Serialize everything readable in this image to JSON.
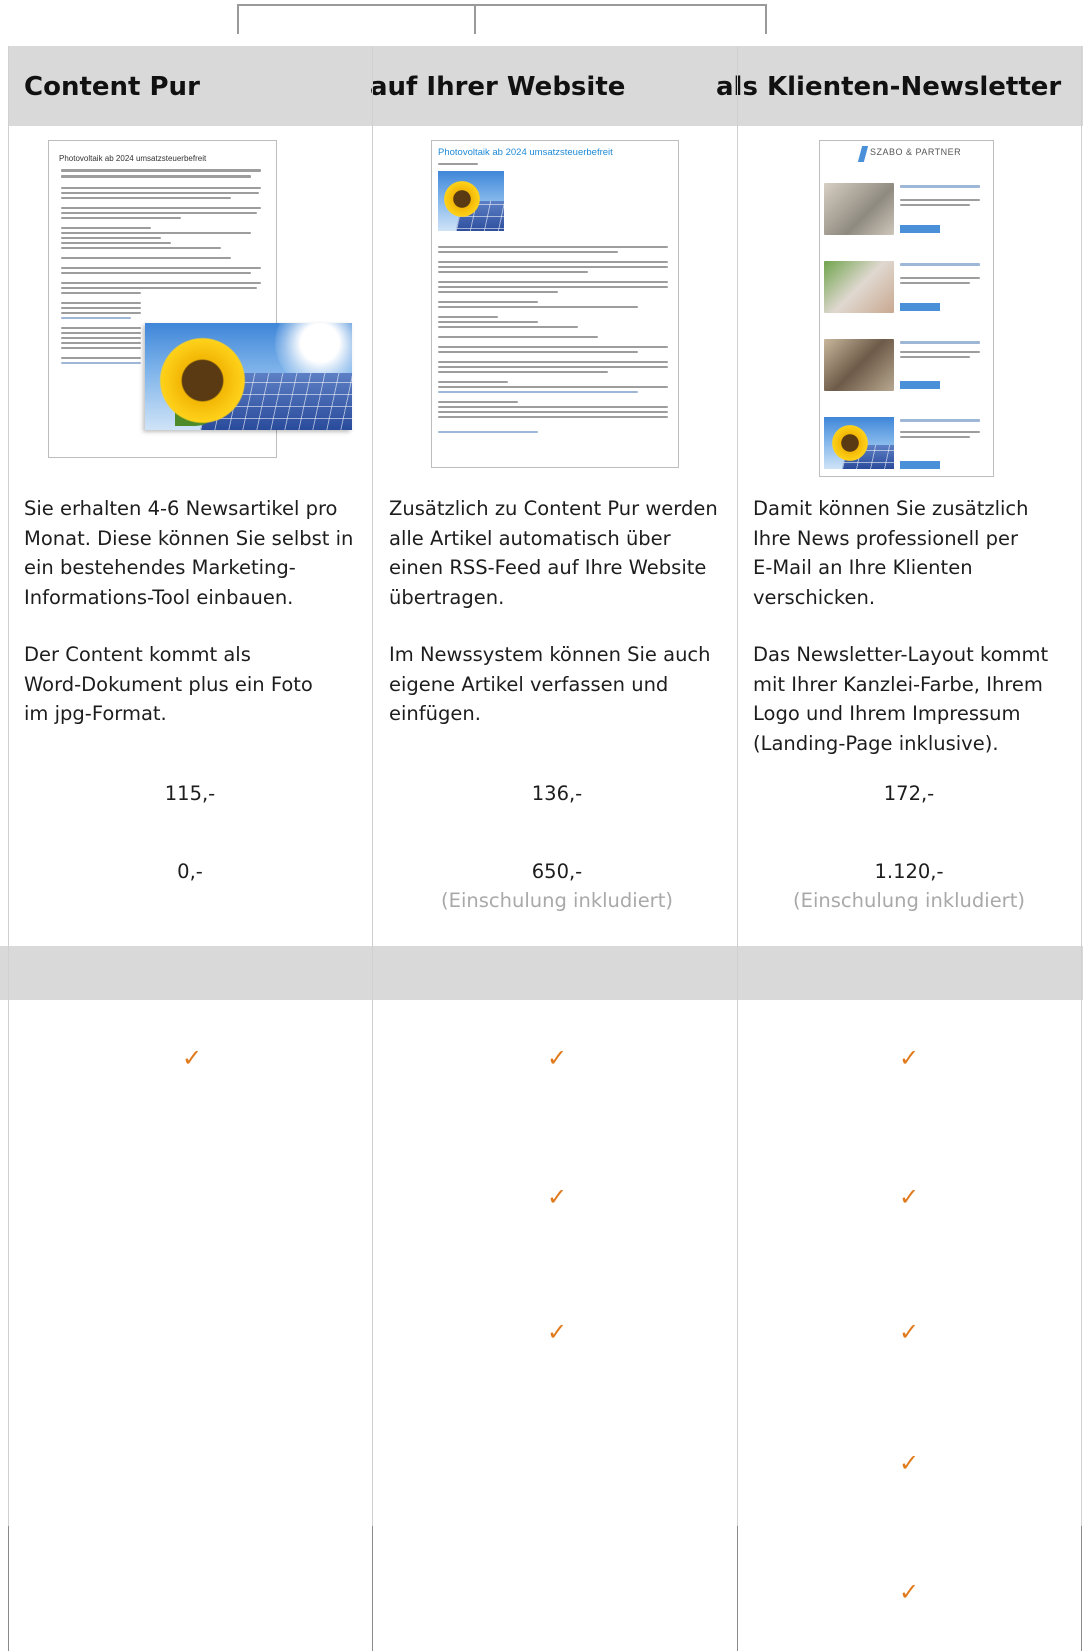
{
  "columns": [
    {
      "title": "Content Pur",
      "preview_title": "Photovoltaik ab 2024 umsatzsteuerbefreit",
      "desc1": [
        "Sie erhalten 4-6 Newsartikel pro",
        "Monat. Diese können Sie selbst in",
        "ein bestehendes Marketing-",
        "Informations-Tool einbauen."
      ],
      "desc2": [
        "Der Content kommt als",
        "Word-Dokument plus ein Foto",
        "im jpg-Format."
      ],
      "price_monthly": "115,-",
      "price_setup": "0,-",
      "setup_note": ""
    },
    {
      "title": "auf Ihrer Website",
      "preview_title": "Photovoltaik ab 2024 umsatzsteuerbefreit",
      "desc1": [
        "Zusätzlich zu Content Pur werden",
        "alle Artikel automatisch über",
        "einen RSS-Feed auf Ihre Website",
        "übertragen."
      ],
      "desc2": [
        "Im Newssystem können Sie auch",
        "eigene Artikel verfassen und",
        "einfügen."
      ],
      "price_monthly": "136,-",
      "price_setup": "650,-",
      "setup_note": "(Einschulung inkludiert)"
    },
    {
      "title": "als Klienten-Newsletter",
      "preview_brand": "SZABO & PARTNER",
      "desc1": [
        "Damit können Sie zusätzlich",
        "Ihre News professionell per",
        "E-Mail an Ihre Klienten",
        "verschicken."
      ],
      "desc2": [
        "Das Newsletter-Layout kommt",
        "mit Ihrer Kanzlei-Farbe, Ihrem",
        "Logo und Ihrem Impressum",
        "(Landing-Page inklusive)."
      ],
      "price_monthly": "172,-",
      "price_setup": "1.120,-",
      "setup_note": "(Einschulung inkludiert)"
    }
  ],
  "feature_checks": [
    [
      true,
      true,
      true
    ],
    [
      false,
      true,
      true
    ],
    [
      false,
      true,
      true
    ],
    [
      false,
      false,
      true
    ],
    [
      false,
      false,
      true
    ]
  ],
  "check_glyph": "✓",
  "colors": {
    "header_bg": "#d9d9d9",
    "check": "#e07a1c",
    "note": "#a9a9a9"
  }
}
